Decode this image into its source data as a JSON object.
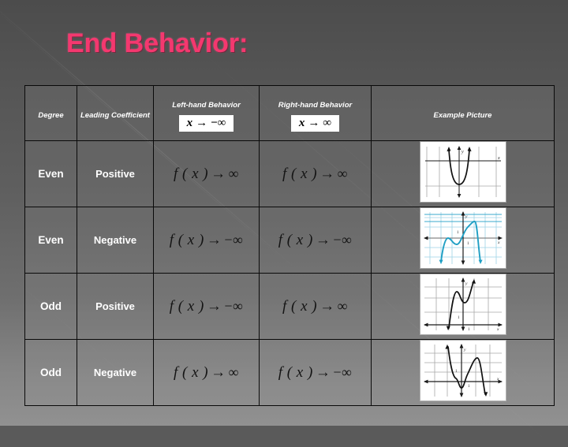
{
  "slide": {
    "title": "End Behavior:",
    "title_color": "#f4386f",
    "background_color": "#5a5a5a"
  },
  "table": {
    "headers": {
      "degree": "Degree",
      "leading_coefficient": "Leading Coefficient",
      "left_hand_behavior": "Left-hand Behavior",
      "right_hand_behavior": "Right-hand Behavior",
      "example_picture": "Example Picture"
    },
    "header_formulas": {
      "left": {
        "var": "x",
        "arrow": "→",
        "limit": "−∞",
        "full": "x → −∞"
      },
      "right": {
        "var": "x",
        "arrow": "→",
        "limit": "∞",
        "full": "x → ∞"
      }
    },
    "rows": [
      {
        "degree": "Even",
        "leading_coefficient": "Positive",
        "left_behavior": {
          "fx": "f ( x )",
          "arrow": "→",
          "limit": "∞",
          "full": "f(x) → ∞"
        },
        "right_behavior": {
          "fx": "f ( x )",
          "arrow": "→",
          "limit": "∞",
          "full": "f(x) → ∞"
        },
        "graph": {
          "shape": "upward-parabola",
          "curve_color": "#111111",
          "grid_color": "#9a9a9a",
          "left_end": "up",
          "right_end": "up"
        }
      },
      {
        "degree": "Even",
        "leading_coefficient": "Negative",
        "left_behavior": {
          "fx": "f ( x )",
          "arrow": "→",
          "limit": "−∞",
          "full": "f(x) → −∞"
        },
        "right_behavior": {
          "fx": "f ( x )",
          "arrow": "→",
          "limit": "−∞",
          "full": "f(x) → −∞"
        },
        "graph": {
          "shape": "even-negative-quartic",
          "curve_color": "#1f9fc4",
          "grid_color": "#7fc6dd",
          "left_end": "down",
          "right_end": "down"
        }
      },
      {
        "degree": "Odd",
        "leading_coefficient": "Positive",
        "left_behavior": {
          "fx": "f ( x )",
          "arrow": "→",
          "limit": "−∞",
          "full": "f(x) → −∞"
        },
        "right_behavior": {
          "fx": "f ( x )",
          "arrow": "→",
          "limit": "∞",
          "full": "f(x) → ∞"
        },
        "graph": {
          "shape": "odd-positive-cubic",
          "curve_color": "#111111",
          "grid_color": "#9a9a9a",
          "left_end": "down",
          "right_end": "up"
        }
      },
      {
        "degree": "Odd",
        "leading_coefficient": "Negative",
        "left_behavior": {
          "fx": "f ( x )",
          "arrow": "→",
          "limit": "∞",
          "full": "f(x) → ∞"
        },
        "right_behavior": {
          "fx": "f ( x )",
          "arrow": "→",
          "limit": "−∞",
          "full": "f(x) → −∞"
        },
        "graph": {
          "shape": "odd-negative-quintic",
          "curve_color": "#111111",
          "grid_color": "#9a9a9a",
          "left_end": "up",
          "right_end": "down"
        }
      }
    ]
  }
}
